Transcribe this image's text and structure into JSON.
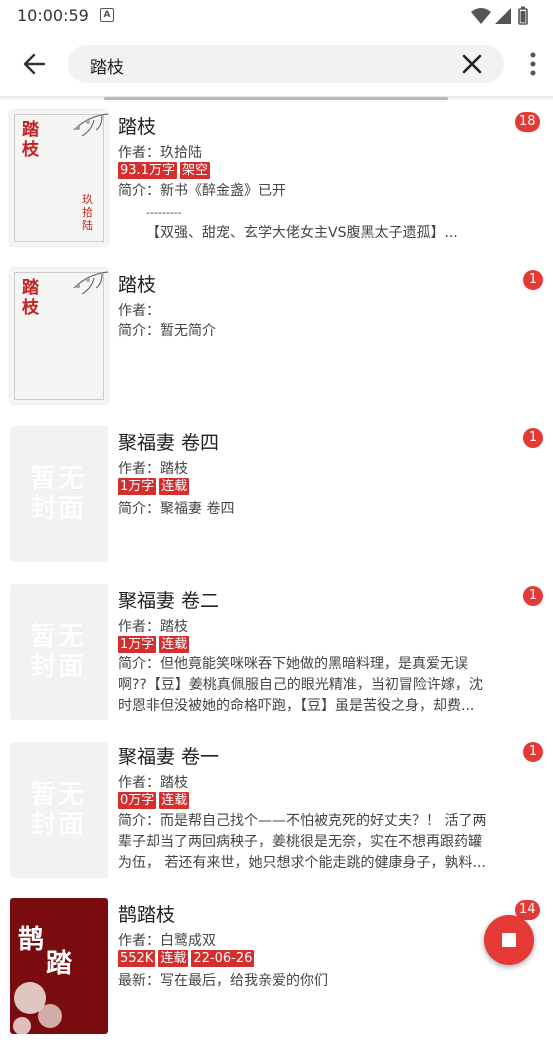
{
  "status_bar": {
    "time": "10:00:59",
    "notification_icon": "A"
  },
  "toolbar": {
    "back_icon": "arrow-left",
    "search_value": "踏枝",
    "clear_icon": "close",
    "more_icon": "more-vert"
  },
  "results": [
    {
      "title": "踏枝",
      "author": "作者：玖拾陆",
      "tags": [
        "93.1万字",
        "架空"
      ],
      "intro_lines": [
        "简介：新书《醉金盏》已开",
        "        ---------",
        "        【双强、甜宠、玄学大佬女主VS腹黑太子遗孤】..."
      ],
      "badge": "18",
      "cover": {
        "style": "paper",
        "title": "踏枝",
        "author": "玖拾陆"
      }
    },
    {
      "title": "踏枝",
      "author": "作者：",
      "tags": [],
      "intro_lines": [
        "简介：暂无简介"
      ],
      "badge": "1",
      "cover": {
        "style": "paper",
        "title": "踏枝",
        "author": ""
      }
    },
    {
      "title": "聚福妻 卷四",
      "author": "作者：踏枝",
      "tags": [
        "1万字",
        "连载"
      ],
      "intro_lines": [
        "简介：聚福妻 卷四"
      ],
      "badge": "1",
      "cover": {
        "style": "placeholder",
        "text": "暂无封面"
      }
    },
    {
      "title": "聚福妻 卷二",
      "author": "作者：踏枝",
      "tags": [
        "1万字",
        "连载"
      ],
      "intro_lines": [
        "简介：但他竟能笑咪咪吞下她做的黑暗料理，是真爱无误",
        "啊??【豆】姜桃真佩服自己的眼光精准，当初冒险许嫁，沈",
        "时恩非但没被她的命格吓跑，【豆】虽是苦役之身，却费..."
      ],
      "badge": "1",
      "cover": {
        "style": "placeholder",
        "text": "暂无封面"
      }
    },
    {
      "title": "聚福妻 卷一",
      "author": "作者：踏枝",
      "tags": [
        "0万字",
        "连载"
      ],
      "intro_lines": [
        "简介：而是帮自己找个——不怕被克死的好丈夫？！ 活了两",
        "辈子却当了两回病秧子，姜桃很是无奈，实在不想再跟药罐",
        "为伍， 若还有来世，她只想求个能走跳的健康身子，孰料..."
      ],
      "badge": "1",
      "cover": {
        "style": "placeholder",
        "text": "暂无封面"
      }
    },
    {
      "title": "鹊踏枝",
      "author": "作者：白鹭成双",
      "tags": [
        "552K",
        "连载",
        "22-06-26"
      ],
      "intro_lines": [
        "最新：写在最后，给我亲爱的你们"
      ],
      "badge": "14",
      "cover": {
        "style": "red",
        "title": "鹊踏枝"
      }
    }
  ],
  "fab": {
    "icon": "stop"
  }
}
